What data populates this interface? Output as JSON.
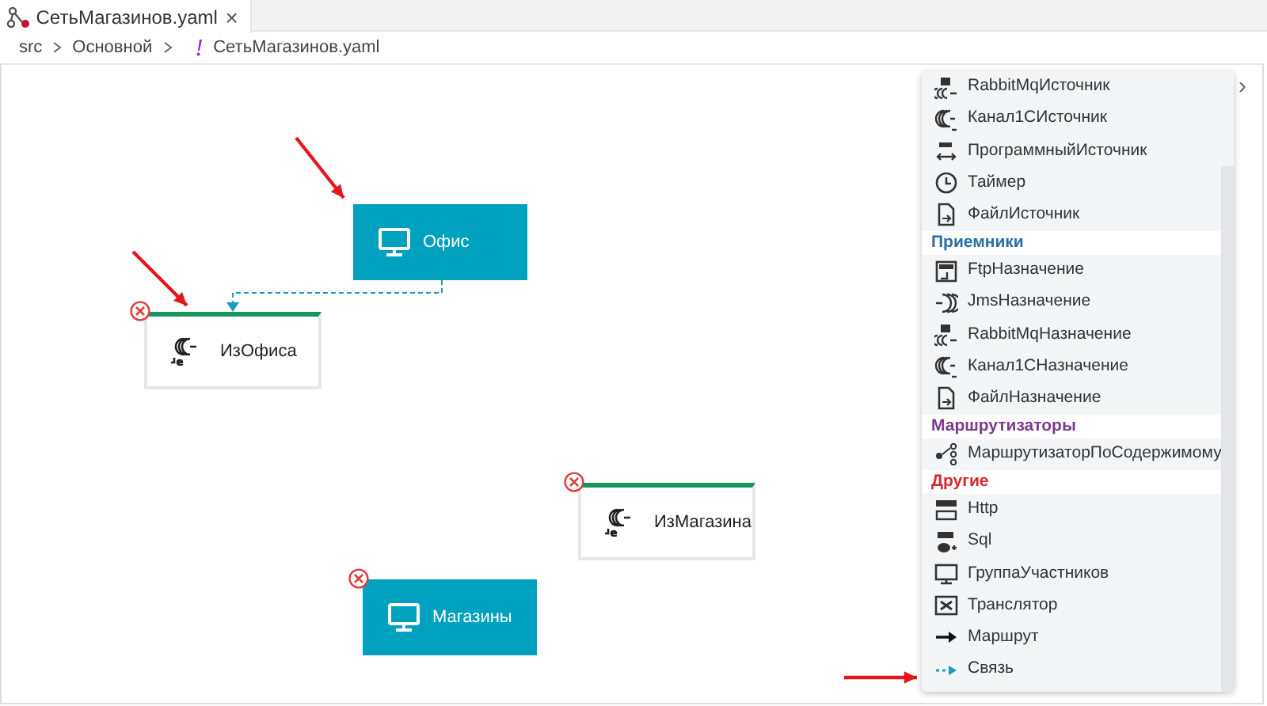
{
  "tab": {
    "title": "СетьМагазинов.yaml",
    "close": "×"
  },
  "breadcrumb": [
    {
      "label": "src",
      "kind": "folder"
    },
    {
      "label": "Основной",
      "kind": "folder"
    },
    {
      "label": "СетьМагазинов.yaml",
      "kind": "file"
    }
  ],
  "nodes": [
    {
      "label": "Офис",
      "kind": "group",
      "error": false
    },
    {
      "label": "ИзОфиса",
      "kind": "endpoint",
      "error": true
    },
    {
      "label": "ИзМагазина",
      "kind": "endpoint",
      "error": true
    },
    {
      "label": "Магазины",
      "kind": "group",
      "error": true
    }
  ],
  "palette": {
    "sections": [
      {
        "items": [
          {
            "label": "RabbitMqИсточник"
          },
          {
            "label": "Канал1СИсточник"
          },
          {
            "label": "ПрограммныйИсточник"
          },
          {
            "label": "Таймер"
          },
          {
            "label": "ФайлИсточник"
          }
        ]
      },
      {
        "title": "Приемники",
        "color": "#2a6ea6",
        "items": [
          {
            "label": "FtpНазначение"
          },
          {
            "label": "JmsНазначение"
          },
          {
            "label": "RabbitMqНазначение"
          },
          {
            "label": "Канал1СНазначение"
          },
          {
            "label": "ФайлНазначение"
          }
        ]
      },
      {
        "title": "Маршрутизаторы",
        "color": "#7b3a8c",
        "items": [
          {
            "label": "МаршрутизаторПоСодержимому"
          }
        ]
      },
      {
        "title": "Другие",
        "color": "#d9262b",
        "items": [
          {
            "label": "Http"
          },
          {
            "label": "Sql"
          },
          {
            "label": "ГруппаУчастников"
          },
          {
            "label": "Транслятор"
          },
          {
            "label": "Маршрут"
          },
          {
            "label": "Связь"
          }
        ]
      }
    ]
  },
  "palette_toggle": "›"
}
